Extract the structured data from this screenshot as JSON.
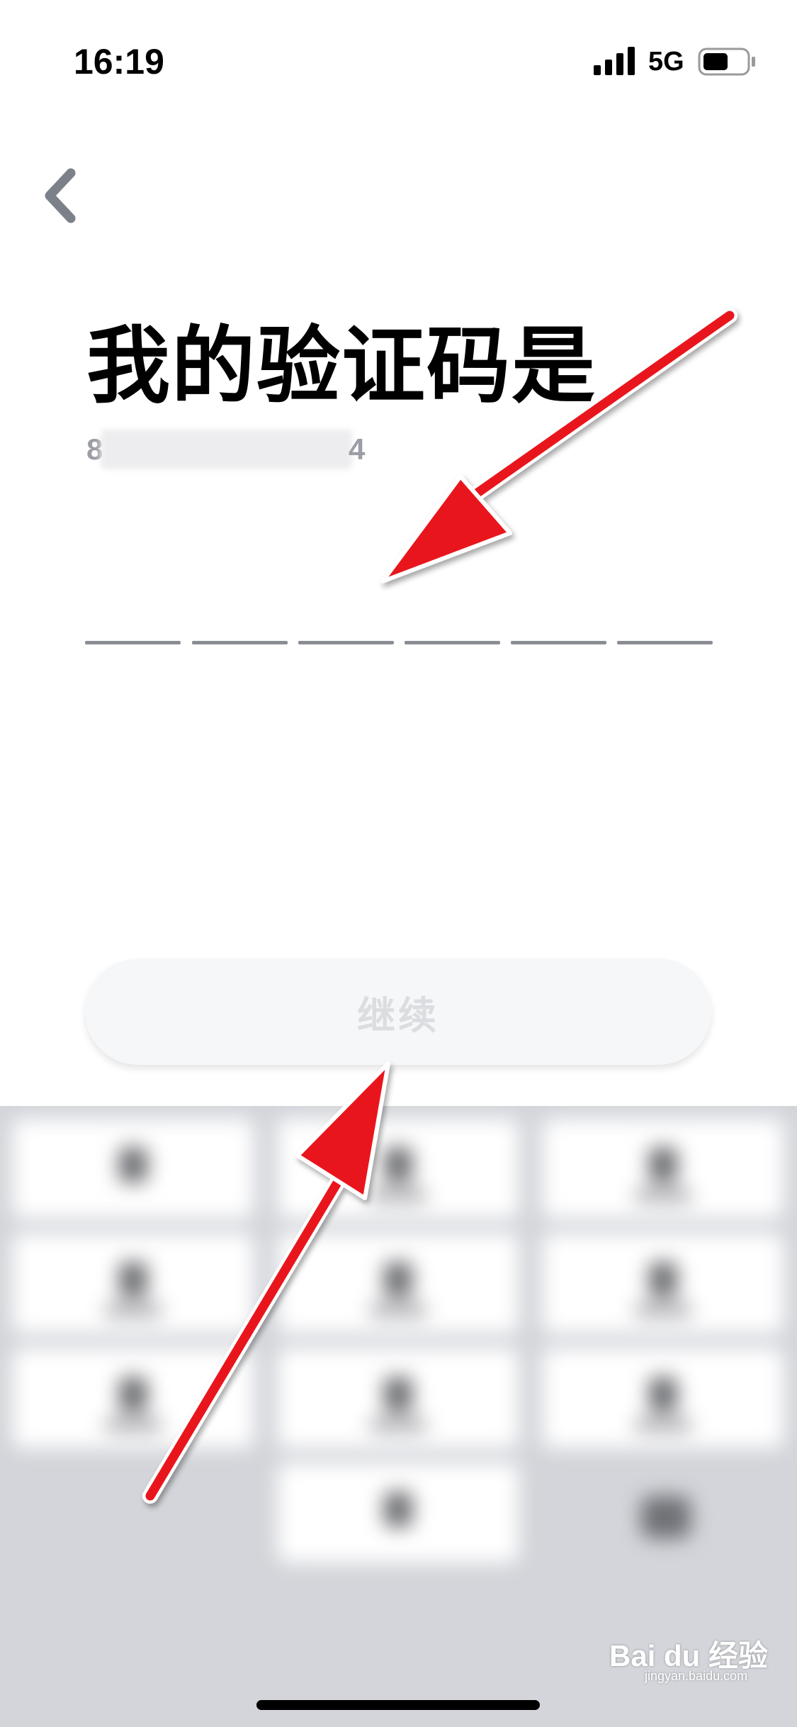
{
  "status_bar": {
    "time": "16:19",
    "network": "5G",
    "icons": [
      "signal-icon",
      "battery-icon"
    ]
  },
  "nav": {
    "back_icon": "chevron-left-icon"
  },
  "page": {
    "title": "我的验证码是",
    "phone_prefix": "8",
    "phone_suffix": "4"
  },
  "code_input": {
    "length": 6,
    "values": [
      "",
      "",
      "",
      "",
      "",
      ""
    ]
  },
  "continue_button": {
    "label": "继续",
    "enabled": false
  },
  "watermark": {
    "logo": "Bai du 经验",
    "url": "jingyan.baidu.com"
  },
  "colors": {
    "annotation_arrow": "#e8141b",
    "button_bg": "#f6f7f9",
    "button_text_disabled": "#dcdde0",
    "input_underline": "#8a8d93",
    "keypad_bg": "#d3d5da"
  }
}
